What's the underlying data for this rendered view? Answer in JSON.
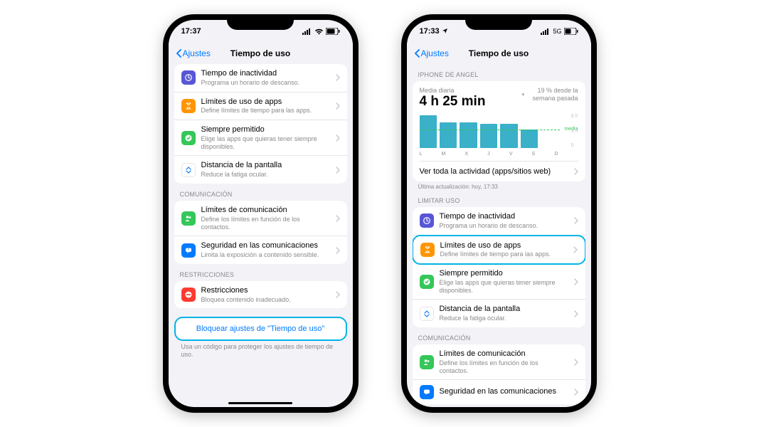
{
  "phone1": {
    "status_time": "17:37",
    "nav_back": "Ajustes",
    "nav_title": "Tiempo de uso",
    "rows": [
      {
        "title": "Tiempo de inactividad",
        "sub": "Programa un horario de descanso."
      },
      {
        "title": "Límites de uso de apps",
        "sub": "Define límites de tiempo para las apps."
      },
      {
        "title": "Siempre permitido",
        "sub": "Elige las apps que quieras tener siempre disponibles."
      },
      {
        "title": "Distancia de la pantalla",
        "sub": "Reduce la fatiga ocular."
      }
    ],
    "section_comm": "COMUNICACIÓN",
    "comm_rows": [
      {
        "title": "Límites de comunicación",
        "sub": "Define los límites en función de los contactos."
      },
      {
        "title": "Seguridad en las comunicaciones",
        "sub": "Limita la exposición a contenido sensible."
      }
    ],
    "section_rest": "RESTRICCIONES",
    "rest_row": {
      "title": "Restricciones",
      "sub": "Bloquea contenido inadecuado."
    },
    "lock_label": "Bloquear ajustes de \"Tiempo de uso\"",
    "footer": "Usa un código para proteger los ajustes de tiempo de uso."
  },
  "phone2": {
    "status_time": "17:33",
    "status_net": "5G",
    "nav_back": "Ajustes",
    "nav_title": "Tiempo de uso",
    "section_device": "IPHONE DE ANGEL",
    "avg_label": "Media diaria",
    "avg_value": "4 h 25 min",
    "delta": "19 % desde la semana pasada",
    "view_all": "Ver toda la actividad (apps/sitios web)",
    "last_update": "Última actualización: hoy, 17:33",
    "section_limit": "LIMITAR USO",
    "limit_rows": [
      {
        "title": "Tiempo de inactividad",
        "sub": "Programa un horario de descanso."
      },
      {
        "title": "Límites de uso de apps",
        "sub": "Define límites de tiempo para las apps."
      },
      {
        "title": "Siempre permitido",
        "sub": "Elige las apps que quieras tener siempre disponibles."
      },
      {
        "title": "Distancia de la pantalla",
        "sub": "Reduce la fatiga ocular."
      }
    ],
    "section_comm": "COMUNICACIÓN",
    "comm_rows": [
      {
        "title": "Límites de comunicación",
        "sub": "Define los límites en función de los contactos."
      },
      {
        "title": "Seguridad en las comunicaciones",
        "sub": ""
      }
    ],
    "yticks": [
      "6 h",
      "3 h",
      "0"
    ],
    "media_label": "media"
  },
  "chart_data": {
    "type": "bar",
    "title": "Media diaria",
    "categories": [
      "L",
      "M",
      "X",
      "J",
      "V",
      "S",
      "D"
    ],
    "values": [
      5.8,
      4.5,
      4.5,
      4.3,
      4.2,
      3.2,
      0
    ],
    "mean_line": 4.42,
    "ylim": [
      0,
      6
    ],
    "ylabel": "h",
    "delta_pct": 19
  }
}
